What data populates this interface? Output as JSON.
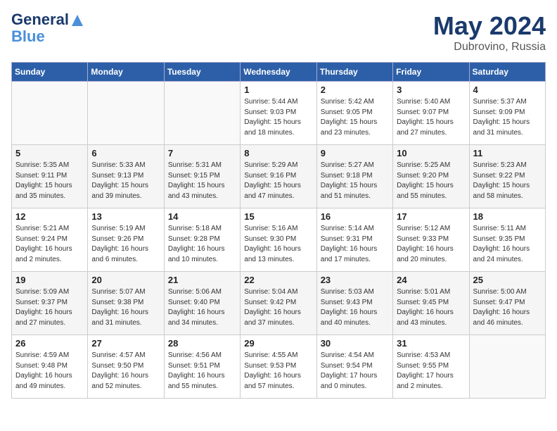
{
  "header": {
    "logo_line1": "General",
    "logo_line2": "Blue",
    "month": "May 2024",
    "location": "Dubrovino, Russia"
  },
  "weekdays": [
    "Sunday",
    "Monday",
    "Tuesday",
    "Wednesday",
    "Thursday",
    "Friday",
    "Saturday"
  ],
  "weeks": [
    [
      {
        "day": "",
        "info": ""
      },
      {
        "day": "",
        "info": ""
      },
      {
        "day": "",
        "info": ""
      },
      {
        "day": "1",
        "info": "Sunrise: 5:44 AM\nSunset: 9:03 PM\nDaylight: 15 hours\nand 18 minutes."
      },
      {
        "day": "2",
        "info": "Sunrise: 5:42 AM\nSunset: 9:05 PM\nDaylight: 15 hours\nand 23 minutes."
      },
      {
        "day": "3",
        "info": "Sunrise: 5:40 AM\nSunset: 9:07 PM\nDaylight: 15 hours\nand 27 minutes."
      },
      {
        "day": "4",
        "info": "Sunrise: 5:37 AM\nSunset: 9:09 PM\nDaylight: 15 hours\nand 31 minutes."
      }
    ],
    [
      {
        "day": "5",
        "info": "Sunrise: 5:35 AM\nSunset: 9:11 PM\nDaylight: 15 hours\nand 35 minutes."
      },
      {
        "day": "6",
        "info": "Sunrise: 5:33 AM\nSunset: 9:13 PM\nDaylight: 15 hours\nand 39 minutes."
      },
      {
        "day": "7",
        "info": "Sunrise: 5:31 AM\nSunset: 9:15 PM\nDaylight: 15 hours\nand 43 minutes."
      },
      {
        "day": "8",
        "info": "Sunrise: 5:29 AM\nSunset: 9:16 PM\nDaylight: 15 hours\nand 47 minutes."
      },
      {
        "day": "9",
        "info": "Sunrise: 5:27 AM\nSunset: 9:18 PM\nDaylight: 15 hours\nand 51 minutes."
      },
      {
        "day": "10",
        "info": "Sunrise: 5:25 AM\nSunset: 9:20 PM\nDaylight: 15 hours\nand 55 minutes."
      },
      {
        "day": "11",
        "info": "Sunrise: 5:23 AM\nSunset: 9:22 PM\nDaylight: 15 hours\nand 58 minutes."
      }
    ],
    [
      {
        "day": "12",
        "info": "Sunrise: 5:21 AM\nSunset: 9:24 PM\nDaylight: 16 hours\nand 2 minutes."
      },
      {
        "day": "13",
        "info": "Sunrise: 5:19 AM\nSunset: 9:26 PM\nDaylight: 16 hours\nand 6 minutes."
      },
      {
        "day": "14",
        "info": "Sunrise: 5:18 AM\nSunset: 9:28 PM\nDaylight: 16 hours\nand 10 minutes."
      },
      {
        "day": "15",
        "info": "Sunrise: 5:16 AM\nSunset: 9:30 PM\nDaylight: 16 hours\nand 13 minutes."
      },
      {
        "day": "16",
        "info": "Sunrise: 5:14 AM\nSunset: 9:31 PM\nDaylight: 16 hours\nand 17 minutes."
      },
      {
        "day": "17",
        "info": "Sunrise: 5:12 AM\nSunset: 9:33 PM\nDaylight: 16 hours\nand 20 minutes."
      },
      {
        "day": "18",
        "info": "Sunrise: 5:11 AM\nSunset: 9:35 PM\nDaylight: 16 hours\nand 24 minutes."
      }
    ],
    [
      {
        "day": "19",
        "info": "Sunrise: 5:09 AM\nSunset: 9:37 PM\nDaylight: 16 hours\nand 27 minutes."
      },
      {
        "day": "20",
        "info": "Sunrise: 5:07 AM\nSunset: 9:38 PM\nDaylight: 16 hours\nand 31 minutes."
      },
      {
        "day": "21",
        "info": "Sunrise: 5:06 AM\nSunset: 9:40 PM\nDaylight: 16 hours\nand 34 minutes."
      },
      {
        "day": "22",
        "info": "Sunrise: 5:04 AM\nSunset: 9:42 PM\nDaylight: 16 hours\nand 37 minutes."
      },
      {
        "day": "23",
        "info": "Sunrise: 5:03 AM\nSunset: 9:43 PM\nDaylight: 16 hours\nand 40 minutes."
      },
      {
        "day": "24",
        "info": "Sunrise: 5:01 AM\nSunset: 9:45 PM\nDaylight: 16 hours\nand 43 minutes."
      },
      {
        "day": "25",
        "info": "Sunrise: 5:00 AM\nSunset: 9:47 PM\nDaylight: 16 hours\nand 46 minutes."
      }
    ],
    [
      {
        "day": "26",
        "info": "Sunrise: 4:59 AM\nSunset: 9:48 PM\nDaylight: 16 hours\nand 49 minutes."
      },
      {
        "day": "27",
        "info": "Sunrise: 4:57 AM\nSunset: 9:50 PM\nDaylight: 16 hours\nand 52 minutes."
      },
      {
        "day": "28",
        "info": "Sunrise: 4:56 AM\nSunset: 9:51 PM\nDaylight: 16 hours\nand 55 minutes."
      },
      {
        "day": "29",
        "info": "Sunrise: 4:55 AM\nSunset: 9:53 PM\nDaylight: 16 hours\nand 57 minutes."
      },
      {
        "day": "30",
        "info": "Sunrise: 4:54 AM\nSunset: 9:54 PM\nDaylight: 17 hours\nand 0 minutes."
      },
      {
        "day": "31",
        "info": "Sunrise: 4:53 AM\nSunset: 9:55 PM\nDaylight: 17 hours\nand 2 minutes."
      },
      {
        "day": "",
        "info": ""
      }
    ]
  ]
}
